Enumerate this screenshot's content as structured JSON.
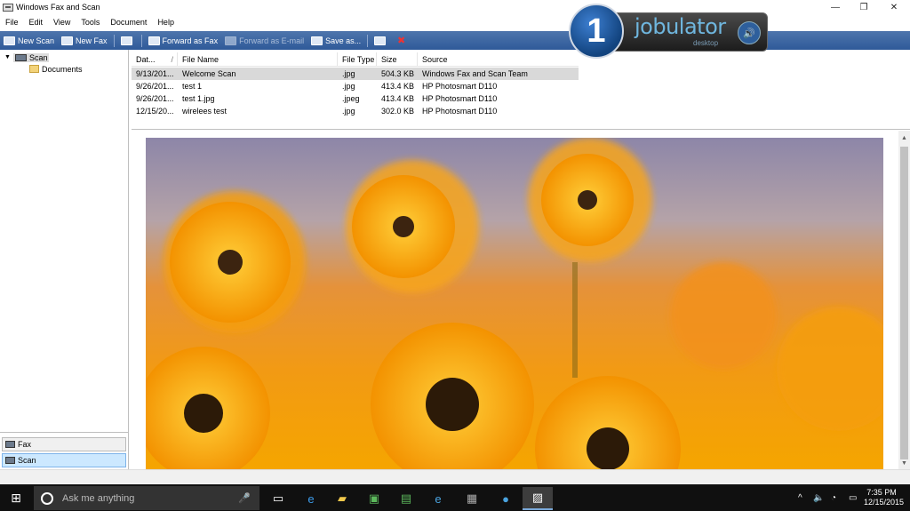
{
  "window": {
    "title": "Windows Fax and Scan",
    "minimize": "—",
    "restore": "❐",
    "close": "✕"
  },
  "menu": [
    "File",
    "Edit",
    "View",
    "Tools",
    "Document",
    "Help"
  ],
  "toolbar": {
    "new_scan": "New Scan",
    "new_fax": "New Fax",
    "forward_fax": "Forward as Fax",
    "forward_email": "Forward as E-mail",
    "save_as": "Save as...",
    "delete_icon": "✖"
  },
  "tree": {
    "root": "Scan",
    "child": "Documents"
  },
  "nav": {
    "fax": "Fax",
    "scan": "Scan"
  },
  "list": {
    "columns": [
      "Dat...",
      "File Name",
      "File Type",
      "Size",
      "Source"
    ],
    "sort_indicator": "/",
    "rows": [
      [
        "9/13/201...",
        "Welcome Scan",
        ".jpg",
        "504.3 KB",
        "Windows Fax and Scan Team"
      ],
      [
        "9/26/201...",
        "test 1",
        ".jpg",
        "413.4 KB",
        "HP Photosmart D110"
      ],
      [
        "9/26/201...",
        "test 1.jpg",
        ".jpeg",
        "413.4 KB",
        "HP Photosmart D110"
      ],
      [
        "12/15/20...",
        "wirelees test",
        ".jpg",
        "302.0 KB",
        "HP Photosmart D110"
      ]
    ]
  },
  "jobulator": {
    "badge": "1",
    "name": "jobulator",
    "sub": "desktop",
    "vol_icon": "🔊"
  },
  "taskbar": {
    "start_icon": "⊞",
    "search_placeholder": "Ask me anything",
    "mic_icon": "🎤",
    "time": "7:35 PM",
    "date": "12/15/2015",
    "tray_up": "^",
    "tray_volume": "🔈",
    "tray_wifi": "◔",
    "tray_msg": "▭"
  },
  "colors": {
    "toolbar": "#3a639e",
    "accent": "#2f5a99",
    "taskbar": "#101010"
  }
}
